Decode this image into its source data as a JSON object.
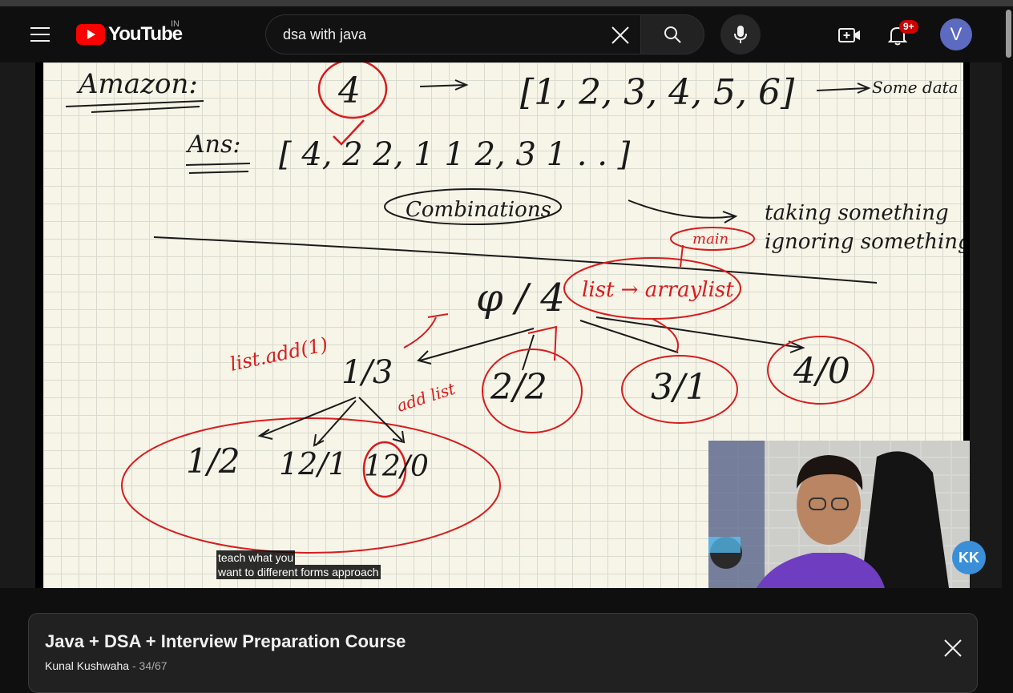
{
  "header": {
    "logo_text": "YouTube",
    "region": "IN",
    "search": {
      "value": "dsa with java",
      "placeholder": "Search"
    },
    "notifications_badge": "9+",
    "avatar_letter": "V"
  },
  "video": {
    "caption_lines": [
      "teach what you",
      "want to different forms approach"
    ],
    "channel_logo": "KK",
    "whiteboard": {
      "amazon": "Amazon:",
      "num4": "4",
      "arrow": "→",
      "array": "[1, 2, 3, 4, 5, 6]",
      "some_data": "Some data",
      "ans": "Ans:",
      "ans_list": "[ 4, 2 2, 1 1 2, 3 1 . . ]",
      "combinations": "Combinations",
      "taking": "taking something",
      "ignoring": "ignoring something,",
      "main": "main",
      "list_arraylist": "list → arraylist",
      "list_add": "list.add(1)",
      "root": "φ / 4",
      "n13": "1/3",
      "n22": "2/2",
      "n31": "3/1",
      "n40": "4/0",
      "leaf12": "1/2",
      "leaf121": "12/1",
      "leaf120": "12/0",
      "add_list": "add list"
    }
  },
  "playlist": {
    "title": "Java + DSA + Interview Preparation Course",
    "channel": "Kunal Kushwaha",
    "position": "34/67"
  },
  "colors": {
    "background": "#0f0f0f",
    "brand_red": "#ff0000",
    "ink_black": "#1a1a1a",
    "ink_red": "#d81c1c",
    "paper": "#f7f4e8",
    "badge": "#cc0000",
    "avatar": "#5c6bc0"
  },
  "icons": [
    "menu-icon",
    "youtube-logo-icon",
    "clear-icon",
    "search-icon",
    "mic-icon",
    "create-video-icon",
    "bell-icon",
    "close-icon"
  ]
}
